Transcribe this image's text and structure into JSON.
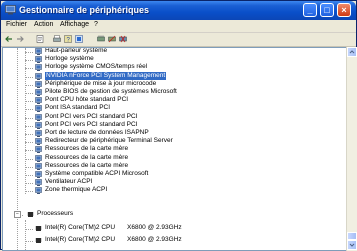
{
  "window": {
    "title": "Gestionnaire de périphériques"
  },
  "menubar": {
    "items": [
      {
        "label": "Fichier",
        "accel": "F",
        "rest": "ichier"
      },
      {
        "label": "Action",
        "accel": "A",
        "rest": "ction"
      },
      {
        "label": "Affichage",
        "accel": "f",
        "pre": "A",
        "rest": "fichage",
        "alt": "Affichage"
      },
      {
        "label": "?"
      }
    ]
  },
  "toolbar": {
    "buttons": [
      "back-icon",
      "forward-icon",
      "properties-icon",
      "print-icon",
      "help-icon",
      "scan-icon",
      "update-driver-icon",
      "disable-icon",
      "uninstall-icon"
    ]
  },
  "tree": {
    "system_devices": [
      "Haut-parleur système",
      "Horloge système",
      "Horloge système CMOS/temps réel",
      "NVIDIA nForce PCI System Management",
      "Périphérique de mise à jour microcode",
      "Pilote BIOS de gestion de systèmes Microsoft",
      "Pont CPU hôte standard PCI",
      "Pont ISA standard PCI",
      "Pont PCI vers PCI standard PCI",
      "Pont PCI vers PCI standard PCI",
      "Port de lecture de données ISAPNP",
      "Redirecteur de périphérique Terminal Server",
      "Ressources de la carte mère",
      "Ressources de la carte mère",
      "Ressources de la carte mère",
      "Système compatible ACPI Microsoft",
      "Ventilateur ACPI",
      "Zone thermique ACPI"
    ],
    "selected_index": 3,
    "processors_label": "Processeurs",
    "processors": [
      {
        "name": "Intel(R) Core(TM)2 CPU",
        "spec": "X6800 @ 2.93GHz"
      },
      {
        "name": "Intel(R) Core(TM)2 CPU",
        "spec": "X6800 @ 2.93GHz"
      }
    ]
  },
  "colors": {
    "title_bar": "#0a4fc9",
    "selection": "#316ac5",
    "window_face": "#ece9d8"
  }
}
